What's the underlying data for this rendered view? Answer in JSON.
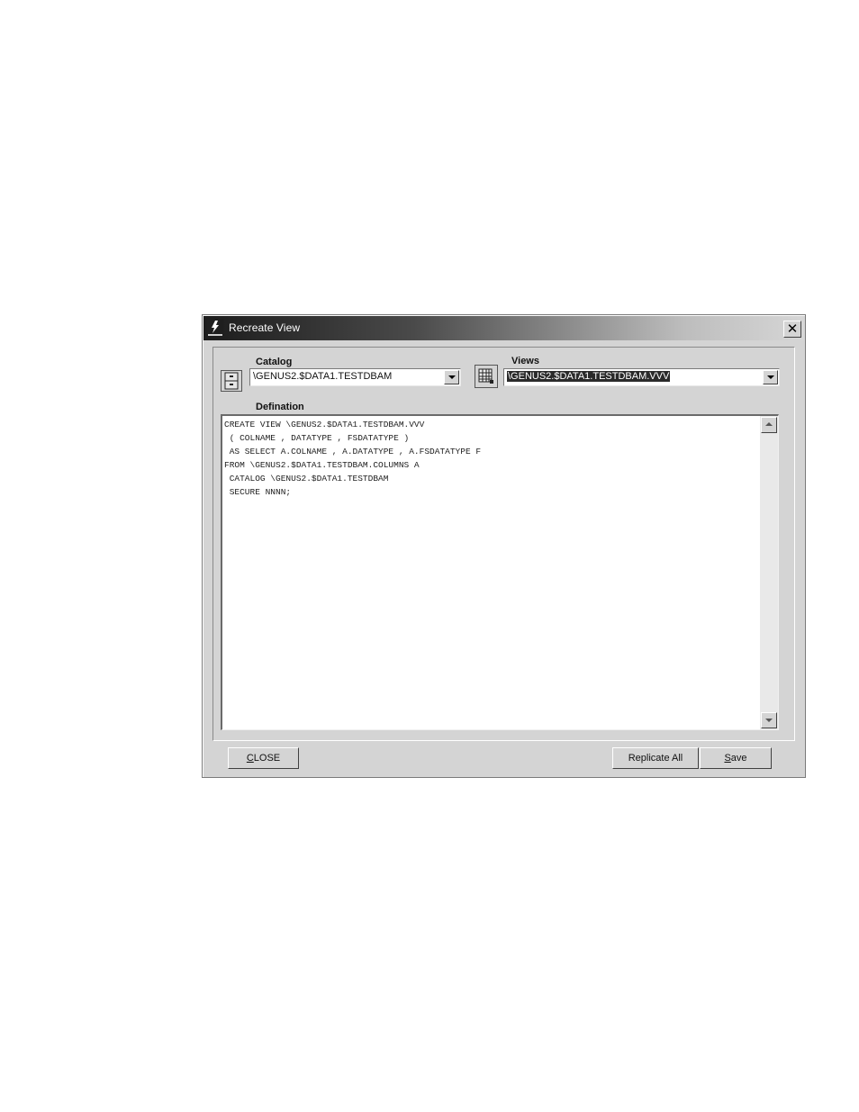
{
  "window": {
    "title": "Recreate View",
    "close_glyph": "✕"
  },
  "catalog": {
    "label": "Catalog",
    "value": "\\GENUS2.$DATA1.TESTDBAM",
    "icon": "cabinet-icon"
  },
  "views": {
    "label": "Views",
    "value": "\\GENUS2.$DATA1.TESTDBAM.VVV",
    "icon": "grid-icon"
  },
  "definition": {
    "label": "Defination",
    "text": "CREATE VIEW \\GENUS2.$DATA1.TESTDBAM.VVV\n ( COLNAME , DATATYPE , FSDATATYPE )\n AS SELECT A.COLNAME , A.DATATYPE , A.FSDATATYPE F\nFROM \\GENUS2.$DATA1.TESTDBAM.COLUMNS A\n CATALOG \\GENUS2.$DATA1.TESTDBAM\n SECURE NNNN;"
  },
  "buttons": {
    "close_first": "C",
    "close_rest": "LOSE",
    "replicate_all": "Replicate All",
    "save_first": "S",
    "save_rest": "ave"
  },
  "colors": {
    "face": "#d4d4d4",
    "selection": "#2a2a2a"
  }
}
